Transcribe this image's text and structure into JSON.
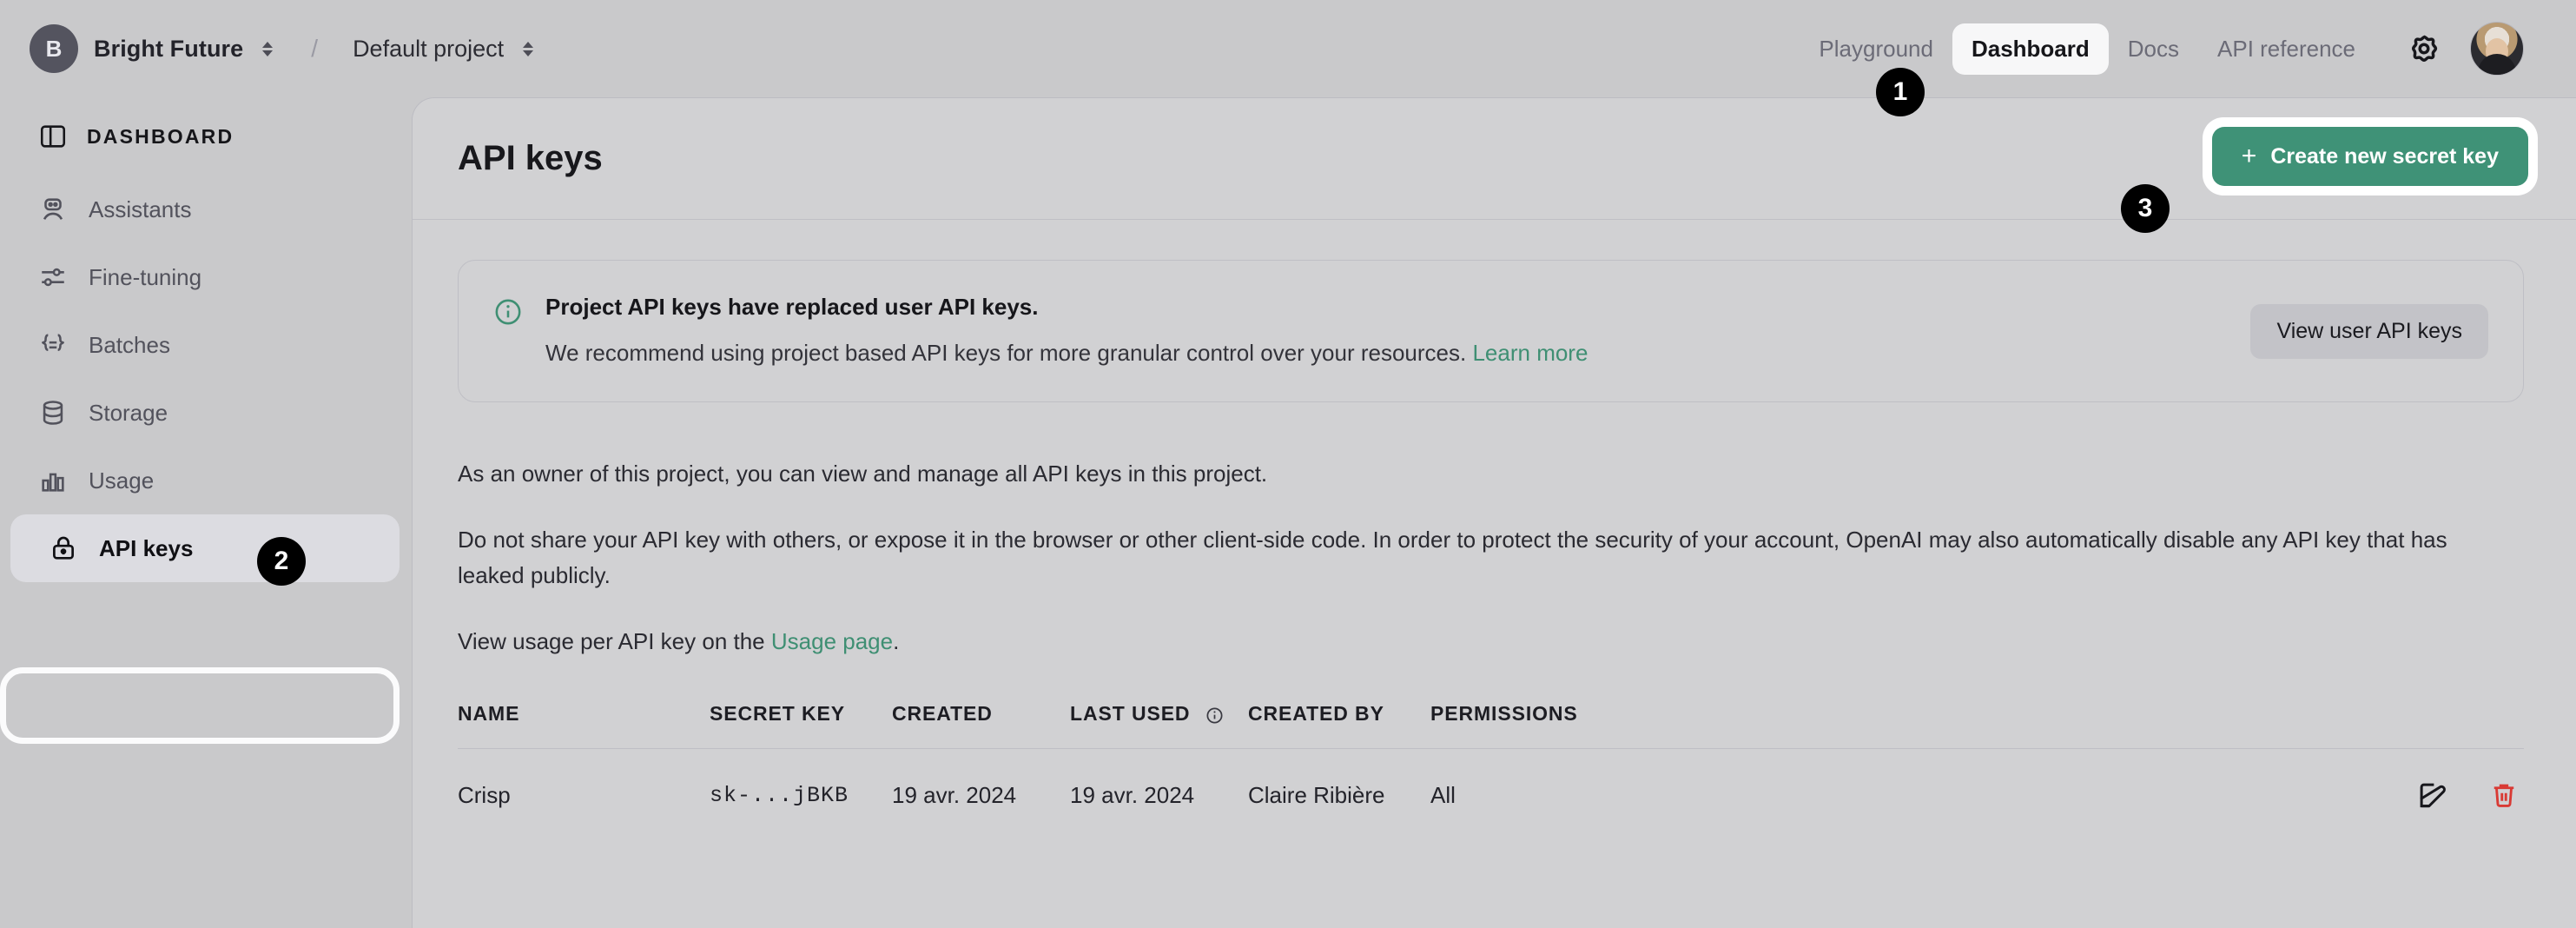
{
  "topbar": {
    "org_initial": "B",
    "org_name": "Bright Future",
    "separator": "/",
    "project_name": "Default project",
    "nav": [
      {
        "label": "Playground",
        "active": false
      },
      {
        "label": "Dashboard",
        "active": true
      },
      {
        "label": "Docs",
        "active": false
      },
      {
        "label": "API reference",
        "active": false
      }
    ],
    "gear_icon": "gear-icon",
    "avatar": "user-avatar"
  },
  "sidebar": {
    "header": "DASHBOARD",
    "items": [
      {
        "label": "Assistants",
        "icon": "robot-icon",
        "active": false
      },
      {
        "label": "Fine-tuning",
        "icon": "sliders-icon",
        "active": false
      },
      {
        "label": "Batches",
        "icon": "braces-icon",
        "active": false
      },
      {
        "label": "Storage",
        "icon": "database-icon",
        "active": false
      },
      {
        "label": "Usage",
        "icon": "bar-chart-icon",
        "active": false
      },
      {
        "label": "API keys",
        "icon": "lock-icon",
        "active": true
      }
    ]
  },
  "page": {
    "title": "API keys",
    "create_button": "Create new secret key",
    "create_button_plus": "+"
  },
  "banner": {
    "icon": "info-circle-icon",
    "title": "Project API keys have replaced user API keys.",
    "subtitle": "We recommend using project based API keys for more granular control over your resources.",
    "link": "Learn more",
    "action_button": "View user API keys"
  },
  "paragraphs": {
    "p1": "As an owner of this project, you can view and manage all API keys in this project.",
    "p2": "Do not share your API key with others, or expose it in the browser or other client-side code. In order to protect the security of your account, OpenAI may also automatically disable any API key that has leaked publicly.",
    "p3_before": "View usage per API key on the ",
    "p3_link": "Usage page",
    "p3_after": "."
  },
  "table": {
    "columns": [
      "NAME",
      "SECRET KEY",
      "CREATED",
      "LAST USED",
      "CREATED BY",
      "PERMISSIONS"
    ],
    "lastused_info_icon": "info-icon",
    "rows": [
      {
        "name": "Crisp",
        "secret_key": "sk-...jBKB",
        "created": "19 avr. 2024",
        "last_used": "19 avr. 2024",
        "created_by": "Claire Ribière",
        "permissions": "All",
        "edit_icon": "edit-icon",
        "delete_icon": "trash-icon"
      }
    ]
  },
  "markers": [
    {
      "id": "1",
      "target": "dashboard-tab"
    },
    {
      "id": "2",
      "target": "sidebar-item-api-keys"
    },
    {
      "id": "3",
      "target": "create-new-secret-key-button"
    }
  ],
  "colors": {
    "accent_green": "#3f9277",
    "link_green": "#3f8f73",
    "danger_red": "#d93a34",
    "page_bg": "#c9c9cb",
    "panel_bg": "#d1d1d3"
  }
}
